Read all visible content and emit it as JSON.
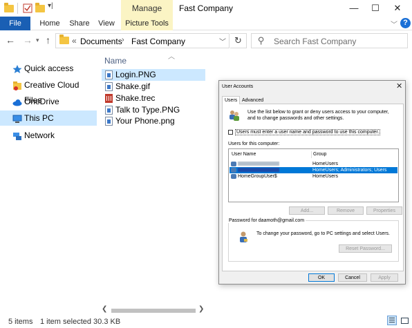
{
  "titlebar": {
    "manage_tab": "Manage",
    "window_title": "Fast Company",
    "minimize": "—",
    "maximize": "☐",
    "close": "✕"
  },
  "ribbon": {
    "tabs": [
      "File",
      "Home",
      "Share",
      "View",
      "Picture Tools"
    ],
    "help": "?"
  },
  "address": {
    "overflow": "«",
    "crumbs": [
      "Documents",
      "Fast Company"
    ],
    "separator": "›",
    "search_placeholder": "Search Fast Company"
  },
  "nav": {
    "items": [
      {
        "label": "Quick access",
        "icon": "star-icon"
      },
      {
        "label": "Creative Cloud Files",
        "icon": "creative-cloud-icon"
      },
      {
        "label": "OneDrive",
        "icon": "cloud-icon"
      },
      {
        "label": "This PC",
        "icon": "computer-icon"
      },
      {
        "label": "Network",
        "icon": "network-icon"
      }
    ],
    "selected": "This PC"
  },
  "filelist": {
    "column_name": "Name",
    "files": [
      {
        "name": "Login.PNG",
        "type": "img"
      },
      {
        "name": "Shake.gif",
        "type": "img"
      },
      {
        "name": "Shake.trec",
        "type": "trec"
      },
      {
        "name": "Talk to Type.PNG",
        "type": "img"
      },
      {
        "name": "Your Phone.png",
        "type": "img"
      }
    ],
    "selected": "Login.PNG"
  },
  "status": {
    "count": "5 items",
    "selected": "1 item selected  30.3 KB"
  },
  "dialog": {
    "title": "User Accounts",
    "close": "✕",
    "tabs": [
      "Users",
      "Advanced"
    ],
    "intro": "Use the list below to grant or deny users access to your computer, and to change passwords and other settings.",
    "checkbox_label": "Users must enter a user name and password to use this computer.",
    "users_heading": "Users for this computer:",
    "columns": [
      "User Name",
      "Group"
    ],
    "users": [
      {
        "name": "",
        "group": "HomeUsers"
      },
      {
        "name": "",
        "group": "HomeUsers; Administrators; Users"
      },
      {
        "name": "HomeGroupUser$",
        "group": "HomeUsers"
      }
    ],
    "buttons": {
      "add": "Add...",
      "remove": "Remove",
      "properties": "Properties",
      "reset": "Reset Password...",
      "ok": "OK",
      "cancel": "Cancel",
      "apply": "Apply"
    },
    "pw_legend": "Password for daamoth@gmail.com",
    "pw_text": "To change your password, go to PC settings and select Users."
  },
  "colors": {
    "accent": "#0078d7",
    "file_tab": "#1a5fb4",
    "picture_tools": "#fbf4c4",
    "selection": "#cce8ff"
  }
}
